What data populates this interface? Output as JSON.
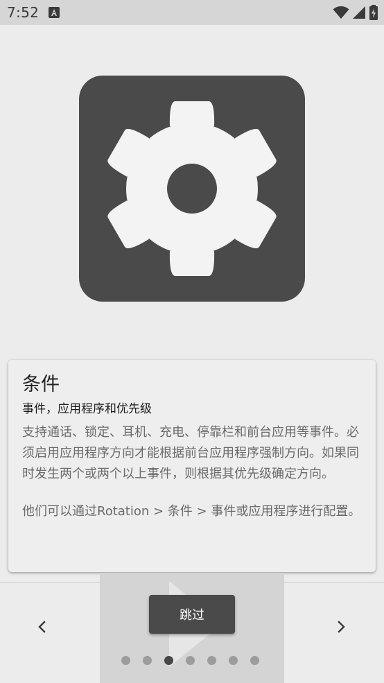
{
  "status_bar": {
    "time": "7:52"
  },
  "card": {
    "title": "条件",
    "subtitle": "事件，应用程序和优先级",
    "body": "支持通话、锁定、耳机、充电、停靠栏和前台应用等事件。必须启用应用程序方向才能根据前台应用程序强制方向。如果同时发生两个或两个以上事件，则根据其优先级确定方向。",
    "note": "他们可以通过Rotation > 条件 > 事件或应用程序进行配置。"
  },
  "footer": {
    "skip_label": "跳过",
    "page_count": 7,
    "current_page": 3
  },
  "icons": {
    "hero": "settings-gear-icon",
    "prev": "chevron-left-icon",
    "next": "chevron-right-icon"
  },
  "colors": {
    "hero_tile": "#4a4a4a",
    "button": "#4a4a4a",
    "background": "#ececec"
  }
}
